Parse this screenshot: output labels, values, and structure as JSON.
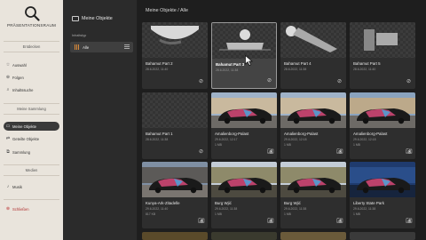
{
  "app": {
    "logo_text": "PRÄSENTATIONSRAUM"
  },
  "sidebar": {
    "sections": [
      {
        "title": "Entdecken",
        "items": [
          {
            "icon": "star-icon",
            "label": "Auswahl"
          },
          {
            "icon": "follow-icon",
            "label": "Folgen"
          },
          {
            "icon": "search-icon",
            "label": "Inhaltssuche"
          }
        ]
      },
      {
        "title": "Meine Sammlung",
        "items": [
          {
            "icon": "folder-icon",
            "label": "Meine Objekte",
            "active": true
          },
          {
            "icon": "share-icon",
            "label": "Geteilte Objekte"
          },
          {
            "icon": "collection-icon",
            "label": "Sammlung"
          }
        ]
      },
      {
        "title": "Medien",
        "items": [
          {
            "icon": "music-icon",
            "label": "Musik"
          }
        ]
      }
    ],
    "close": {
      "icon": "close-icon",
      "label": "Schließen"
    }
  },
  "panel": {
    "title": "Meine Objekte",
    "content_type_label": "Inhaltstyp",
    "filter_all": "Alle"
  },
  "main": {
    "breadcrumb": "Meine Objekte / Alle",
    "cards": [
      {
        "title": "Bahamut Part 2",
        "date": "28.6.2022, 11:40",
        "meta": "",
        "thumb": "part2",
        "icon": "object-icon"
      },
      {
        "title": "Bahamut Part 3",
        "date": "28.6.2022, 11:38",
        "meta": "",
        "thumb": "part3",
        "icon": "object-icon",
        "selected": true
      },
      {
        "title": "Bahamut Part 4",
        "date": "28.6.2022, 11:38",
        "meta": "",
        "thumb": "part4",
        "icon": "object-icon"
      },
      {
        "title": "Bahamut Part 5",
        "date": "28.6.2022, 11:40",
        "meta": "",
        "thumb": "part5",
        "icon": "object-icon"
      },
      {
        "title": "Bahamut Part 1",
        "date": "28.6.2022, 11:38",
        "meta": "",
        "thumb": "part1",
        "icon": "object-icon"
      },
      {
        "title": "Amalienborg-Palast",
        "date": "29.6.2022, 12:17",
        "meta": "1 MB",
        "thumb": "car-palace",
        "icon": "camera-icon"
      },
      {
        "title": "Amalienborg-Palast",
        "date": "29.6.2022, 12:18",
        "meta": "1 MB",
        "thumb": "car-palace",
        "icon": "camera-icon"
      },
      {
        "title": "Amalienborg-Palast",
        "date": "29.6.2022, 12:18",
        "meta": "1 MB",
        "thumb": "car-palace2",
        "icon": "camera-icon"
      },
      {
        "title": "Kunya-Ark-Zitadelle",
        "date": "29.6.2022, 11:40",
        "meta": "817 KB",
        "thumb": "car-citadel",
        "icon": "camera-icon"
      },
      {
        "title": "Burg Wjić",
        "date": "29.6.2022, 11:38",
        "meta": "1 MB",
        "thumb": "car-castle",
        "icon": "camera-icon"
      },
      {
        "title": "Burg Wjić",
        "date": "29.6.2022, 11:38",
        "meta": "1 MB",
        "thumb": "car-castle",
        "icon": "camera-icon"
      },
      {
        "title": "Liberty State Park",
        "date": "29.6.2022, 11:38",
        "meta": "1 MB",
        "thumb": "car-night",
        "icon": "camera-icon"
      }
    ]
  },
  "colors": {
    "accent": "#d98a3a",
    "sidebar_bg": "#e9e4dc",
    "active_bg": "#3a3a3a",
    "danger": "#b03030"
  }
}
